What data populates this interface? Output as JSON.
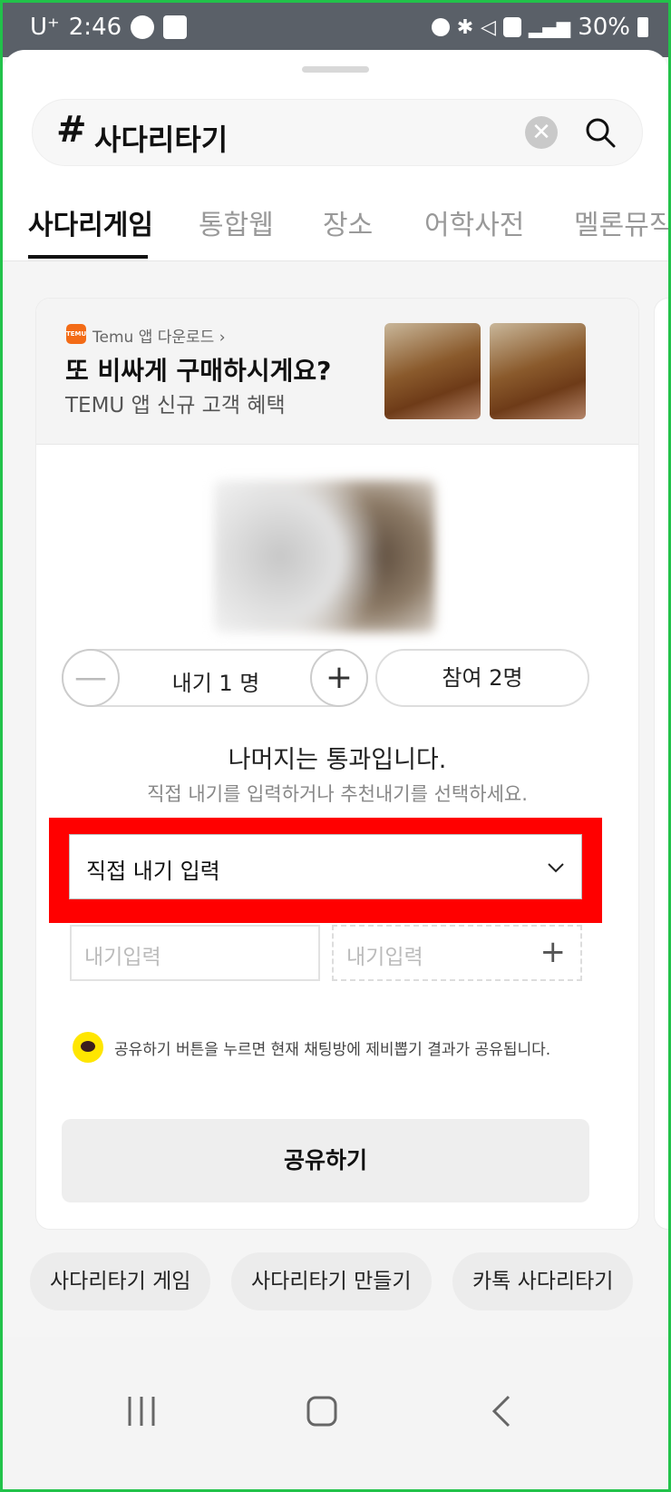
{
  "status_bar": {
    "carrier": "U⁺",
    "time": "2:46",
    "battery": "30%"
  },
  "search": {
    "hash": "#",
    "query": "사다리타기"
  },
  "tabs": [
    {
      "label": "사다리게임"
    },
    {
      "label": "통합웹"
    },
    {
      "label": "장소"
    },
    {
      "label": "어학사전"
    },
    {
      "label": "멜론뮤직"
    }
  ],
  "ad": {
    "logo_text": "TEMU",
    "source": "Temu 앱 다운로드 ›",
    "title": "또 비싸게 구매하시게요?",
    "description": "TEMU 앱 신규 고객 혜택"
  },
  "stepper": {
    "minus": "—",
    "label": "내기 1 명",
    "plus": "+"
  },
  "participants": "참여 2명",
  "rest_text": "나머지는 통과입니다.",
  "guide_text": "직접 내기를 입력하거나 추천내기를 선택하세요.",
  "bet_select": {
    "label": "직접 내기 입력"
  },
  "bet_inputs": {
    "placeholder1": "내기입력",
    "placeholder2": "내기입력",
    "add": "+"
  },
  "notice": "공유하기 버튼을 누르면 현재 채팅방에 제비뽑기 결과가 공유됩니다.",
  "share_button": "공유하기",
  "related": [
    {
      "label": "사다리타기 게임"
    },
    {
      "label": "사다리타기 만들기"
    },
    {
      "label": "카톡 사다리타기"
    }
  ],
  "colors": {
    "highlight": "#ff0000",
    "temu_orange": "#f36b16",
    "kakao_yellow": "#ffe600"
  }
}
